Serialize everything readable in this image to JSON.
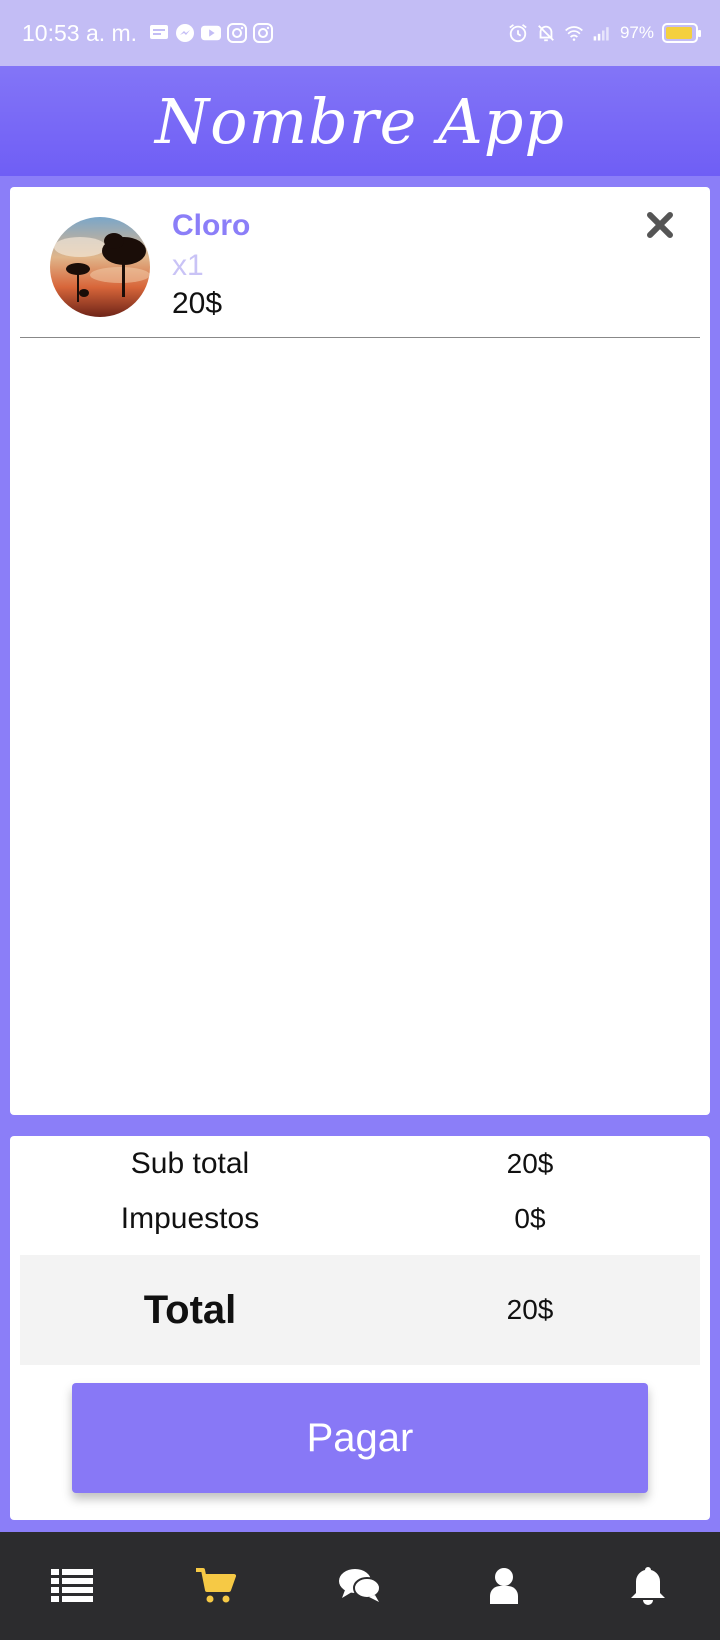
{
  "status_bar": {
    "time": "10:53 a. m.",
    "battery": "97%"
  },
  "header": {
    "title": "Nombre App"
  },
  "cart": {
    "items": [
      {
        "name": "Cloro",
        "quantity": "x1",
        "price": "20$"
      }
    ]
  },
  "summary": {
    "subtotal_label": "Sub total",
    "subtotal_value": "20$",
    "tax_label": "Impuestos",
    "tax_value": "0$",
    "total_label": "Total",
    "total_value": "20$",
    "pay_label": "Pagar"
  },
  "nav": {
    "items": [
      "list-icon",
      "cart-icon",
      "chat-icon",
      "user-icon",
      "bell-icon"
    ],
    "active": "cart-icon",
    "active_color": "#f6c945"
  },
  "colors": {
    "accent": "#8b7ef8",
    "header": "#7a6cf6",
    "nav_bg": "#2c2c2e"
  }
}
